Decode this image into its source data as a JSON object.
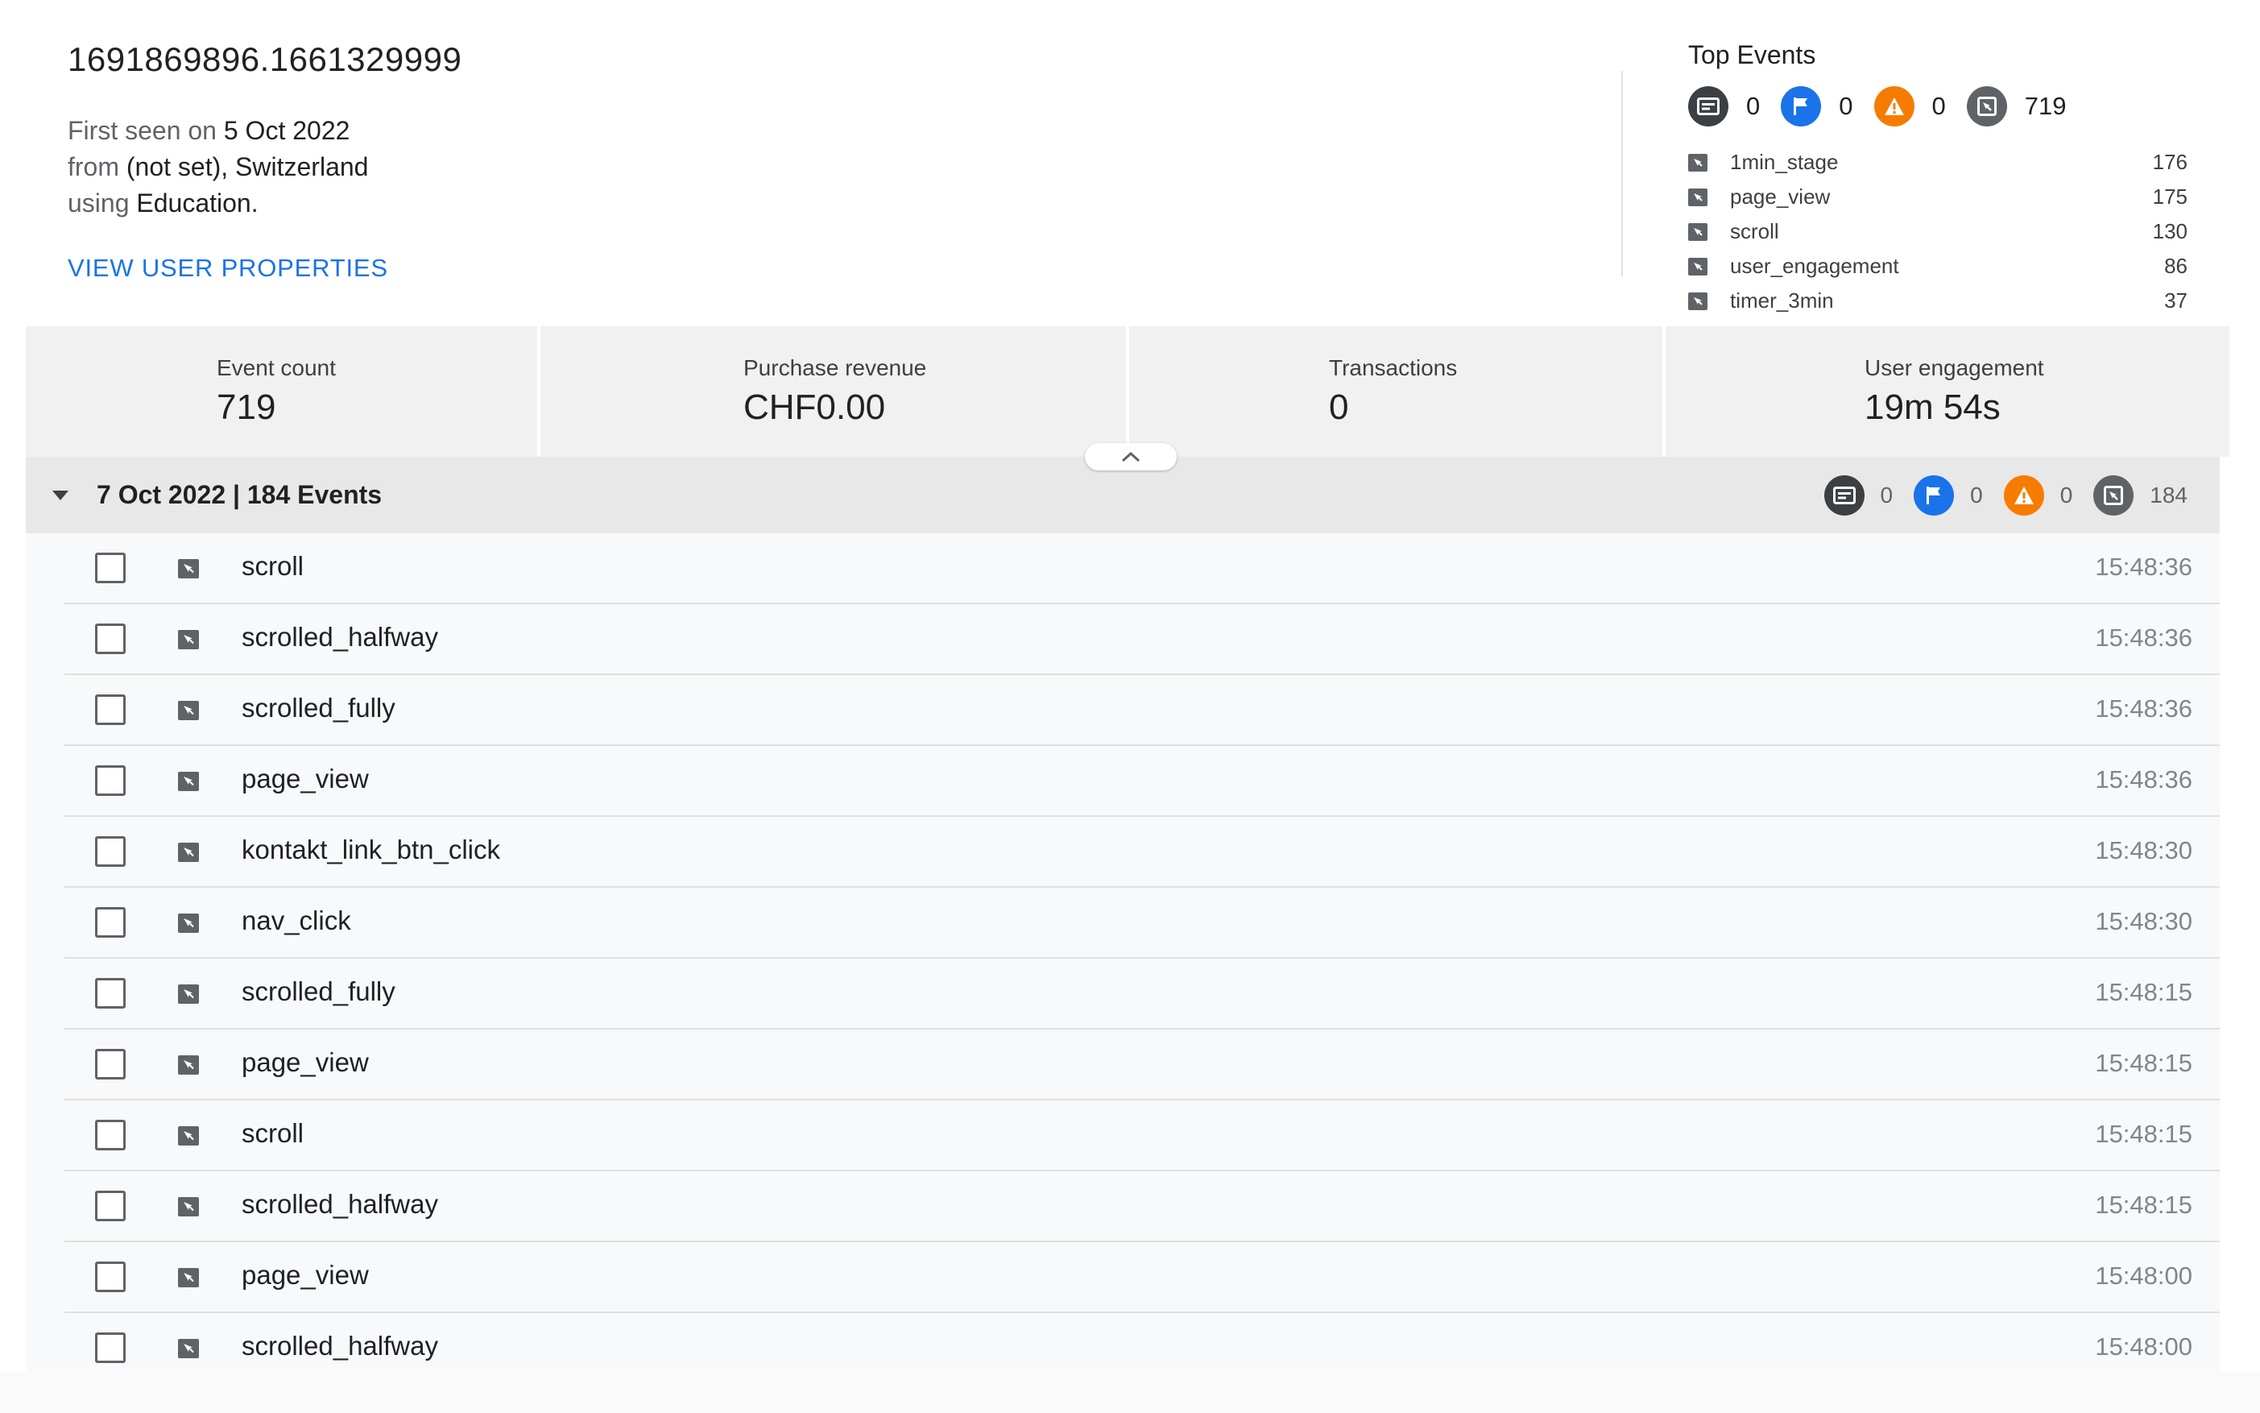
{
  "user": {
    "id": "1691869896.1661329999",
    "first_seen_prefix": "First seen on",
    "first_seen_date": "5 Oct 2022",
    "from_prefix": "from",
    "location": "(not set), Switzerland",
    "using_prefix": "using",
    "category": "Education",
    "view_properties_label": "VIEW USER PROPERTIES"
  },
  "top_events": {
    "title": "Top Events",
    "counters": [
      {
        "icon": "screen-view-icon",
        "value": "0"
      },
      {
        "icon": "flag-icon",
        "value": "0"
      },
      {
        "icon": "warning-icon",
        "value": "0"
      },
      {
        "icon": "event-icon",
        "value": "719"
      }
    ],
    "items": [
      {
        "name": "1min_stage",
        "count": "176"
      },
      {
        "name": "page_view",
        "count": "175"
      },
      {
        "name": "scroll",
        "count": "130"
      },
      {
        "name": "user_engagement",
        "count": "86"
      },
      {
        "name": "timer_3min",
        "count": "37"
      }
    ]
  },
  "metrics": [
    {
      "label": "Event count",
      "value": "719"
    },
    {
      "label": "Purchase revenue",
      "value": "CHF0.00"
    },
    {
      "label": "Transactions",
      "value": "0"
    },
    {
      "label": "User engagement",
      "value": "19m 54s"
    }
  ],
  "day": {
    "title": "7 Oct 2022 | 184 Events",
    "counters": [
      {
        "icon": "screen-view-icon",
        "value": "0"
      },
      {
        "icon": "flag-icon",
        "value": "0"
      },
      {
        "icon": "warning-icon",
        "value": "0"
      },
      {
        "icon": "event-icon",
        "value": "184"
      }
    ]
  },
  "events": [
    {
      "name": "scroll",
      "time": "15:48:36"
    },
    {
      "name": "scrolled_halfway",
      "time": "15:48:36"
    },
    {
      "name": "scrolled_fully",
      "time": "15:48:36"
    },
    {
      "name": "page_view",
      "time": "15:48:36"
    },
    {
      "name": "kontakt_link_btn_click",
      "time": "15:48:30"
    },
    {
      "name": "nav_click",
      "time": "15:48:30"
    },
    {
      "name": "scrolled_fully",
      "time": "15:48:15"
    },
    {
      "name": "page_view",
      "time": "15:48:15"
    },
    {
      "name": "scroll",
      "time": "15:48:15"
    },
    {
      "name": "scrolled_halfway",
      "time": "15:48:15"
    },
    {
      "name": "page_view",
      "time": "15:48:00"
    },
    {
      "name": "scrolled_halfway",
      "time": "15:48:00"
    }
  ],
  "colors": {
    "accent_blue": "#1a73e8",
    "warning_orange": "#f57c00",
    "dark_badge": "#3c4043",
    "gray_badge": "#5f6368"
  }
}
